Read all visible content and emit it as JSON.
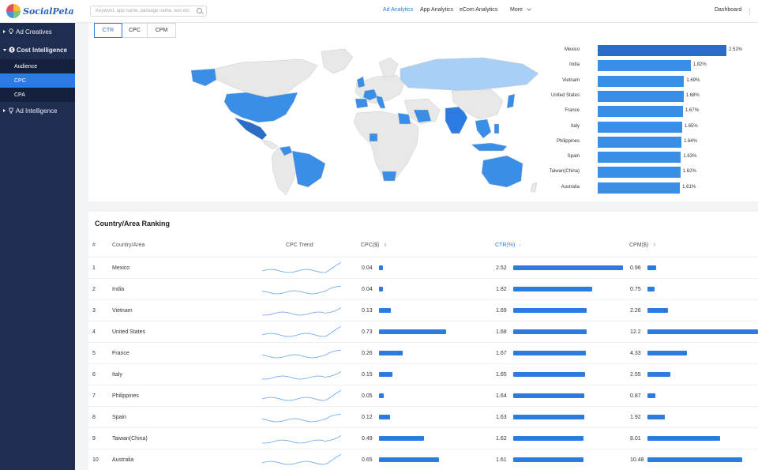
{
  "app": {
    "logo_text": "SocialPeta"
  },
  "search": {
    "placeholder": "Keyword, app name, package name, text etc."
  },
  "nav": {
    "items": [
      "Ad Analytics",
      "App Analytics",
      "eCom Analytics",
      "More"
    ],
    "dashboard": "Dashboard"
  },
  "sidebar": {
    "ad_creatives": "Ad Creatives",
    "cost_intelligence": "Cost Intelligence",
    "subs": [
      "Audience",
      "CPC",
      "CPA"
    ],
    "ad_intelligence": "Ad Intelligence"
  },
  "tabs": [
    "CTR",
    "CPC",
    "CPM"
  ],
  "top_ranking": [
    {
      "country": "Mexico",
      "value": 2.52,
      "label": "2.52%"
    },
    {
      "country": "India",
      "value": 1.82,
      "label": "1.82%"
    },
    {
      "country": "Vietnam",
      "value": 1.69,
      "label": "1.69%"
    },
    {
      "country": "United States",
      "value": 1.68,
      "label": "1.68%"
    },
    {
      "country": "France",
      "value": 1.67,
      "label": "1.67%"
    },
    {
      "country": "Italy",
      "value": 1.65,
      "label": "1.65%"
    },
    {
      "country": "Philippines",
      "value": 1.64,
      "label": "1.64%"
    },
    {
      "country": "Spain",
      "value": 1.63,
      "label": "1.63%"
    },
    {
      "country": "Taiwan(China)",
      "value": 1.62,
      "label": "1.62%"
    },
    {
      "country": "Australia",
      "value": 1.61,
      "label": "1.61%"
    }
  ],
  "table": {
    "title": "Country/Area Ranking",
    "headers": {
      "rank": "#",
      "country": "Country/Area",
      "trend": "CPC Trend",
      "cpc": "CPC($)",
      "ctr": "CTR(%)",
      "cpm": "CPM($)"
    },
    "rows": [
      {
        "rank": "1",
        "country": "Mexico",
        "cpc": "0.04",
        "ctr": "2.52",
        "cpm": "0.96"
      },
      {
        "rank": "2",
        "country": "India",
        "cpc": "0.04",
        "ctr": "1.82",
        "cpm": "0.75"
      },
      {
        "rank": "3",
        "country": "Vietnam",
        "cpc": "0.13",
        "ctr": "1.69",
        "cpm": "2.26"
      },
      {
        "rank": "4",
        "country": "United States",
        "cpc": "0.73",
        "ctr": "1.68",
        "cpm": "12.2"
      },
      {
        "rank": "5",
        "country": "France",
        "cpc": "0.26",
        "ctr": "1.67",
        "cpm": "4.33"
      },
      {
        "rank": "6",
        "country": "Italy",
        "cpc": "0.15",
        "ctr": "1.65",
        "cpm": "2.55"
      },
      {
        "rank": "7",
        "country": "Philippines",
        "cpc": "0.05",
        "ctr": "1.64",
        "cpm": "0.87"
      },
      {
        "rank": "8",
        "country": "Spain",
        "cpc": "0.12",
        "ctr": "1.63",
        "cpm": "1.92"
      },
      {
        "rank": "9",
        "country": "Taiwan(China)",
        "cpc": "0.49",
        "ctr": "1.62",
        "cpm": "8.01"
      },
      {
        "rank": "10",
        "country": "Australia",
        "cpc": "0.65",
        "ctr": "1.61",
        "cpm": "10.48"
      }
    ]
  },
  "colors": {
    "accent": "#2b7be0",
    "sidebar": "#1e2d50",
    "bar": "#3a8ee6"
  }
}
